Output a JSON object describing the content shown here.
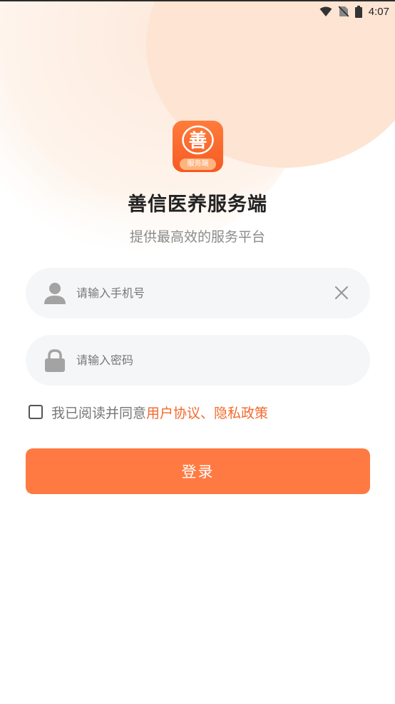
{
  "status_bar": {
    "time": "4:07",
    "icons": [
      "wifi-icon",
      "no-sim-icon",
      "battery-icon"
    ]
  },
  "app": {
    "icon_glyph": "善",
    "icon_badge": "服务端",
    "name": "善信医养服务端",
    "tagline": "提供最高效的服务平台"
  },
  "form": {
    "phone_placeholder": "请输入手机号",
    "password_placeholder": "请输入密码"
  },
  "agreement": {
    "text": "我已阅读并同意",
    "user_agreement": "用户协议",
    "separator": "、",
    "privacy_policy": "隐私政策",
    "checked": false
  },
  "login_button": "登录",
  "colors": {
    "accent": "#ff7a42",
    "link": "#f26a2e",
    "field_bg": "#f5f6f8"
  }
}
